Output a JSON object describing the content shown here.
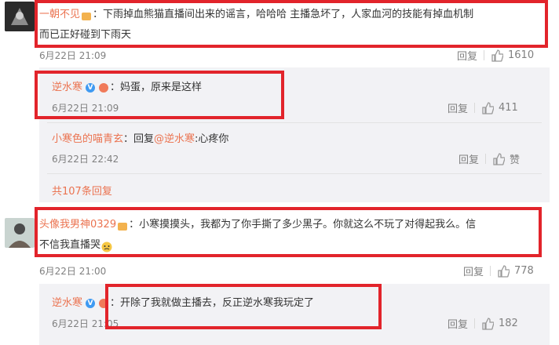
{
  "comments": [
    {
      "user": "一朝不见",
      "text_line1": "：下雨掉血熊猫直播间出来的谣言，哈哈哈 主播急坏了，人家血河的技能有掉血机制",
      "text_line2": "而已正好碰到下雨天",
      "time": "6月22日 21:09",
      "reply_label": "回复",
      "likes": "1610"
    },
    {
      "user": "逆水寒",
      "text": "：妈蛋，原来是这样",
      "time": "6月22日 21:09",
      "reply_label": "回复",
      "likes": "411"
    },
    {
      "user": "小寒色的喵青玄",
      "text_prefix": "：回复",
      "mention": "@逆水寒",
      "text_suffix": ":心疼你",
      "time": "6月22日 22:42",
      "reply_label": "回复",
      "likes": "赞"
    },
    {
      "more_replies": "共107条回复"
    },
    {
      "user": "头像我男神0329",
      "text_line1": "：小寒摸摸头，我都为了你手撕了多少黑子。你就这么不玩了对得起我么。信",
      "text_line2": "不信我直播哭",
      "time": "6月22日 21:00",
      "reply_label": "回复",
      "likes": "778"
    },
    {
      "user": "逆水寒",
      "text": "：开除了我就做主播去，反正逆水寒我玩定了",
      "time": "6月22日 21:05",
      "reply_label": "回复",
      "likes": "182"
    }
  ],
  "colors": {
    "highlight": "#e2242b",
    "username": "#eb7350",
    "verified": "#3f9af2"
  }
}
